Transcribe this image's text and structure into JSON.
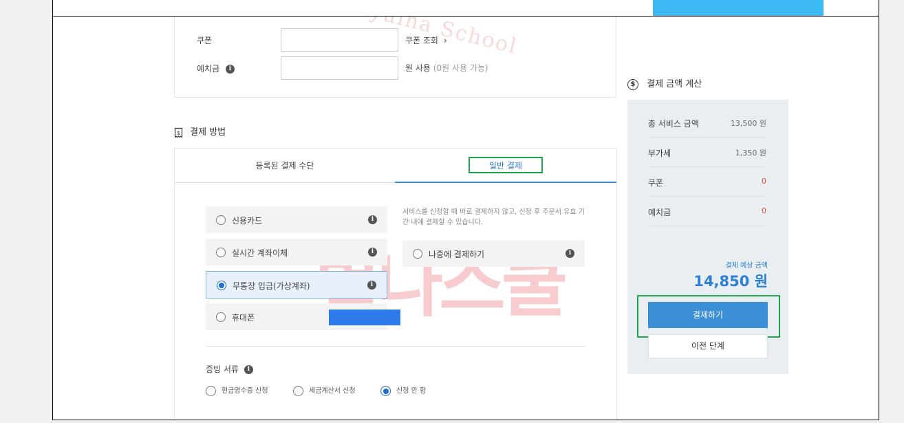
{
  "watermark": {
    "text": "Byulna School",
    "logo_text": "별나스쿨"
  },
  "coupon": {
    "label": "쿠폰",
    "value": "",
    "lookup_label": "쿠폰 조회",
    "lookup_icon": "chevron-right-icon"
  },
  "deposit": {
    "label": "예치금",
    "value": "",
    "use_label": "원 사용",
    "available": "(0원 사용 가능)"
  },
  "payment_method": {
    "title": "결제 방법",
    "icon": "receipt-dollar-icon",
    "tabs": [
      "등록된 결제 수단",
      "일반 결제"
    ],
    "active_tab": "일반 결제",
    "options": [
      {
        "label": "신용카드",
        "selected": false
      },
      {
        "label": "실시간 계좌이체",
        "selected": false
      },
      {
        "label": "무통장 입금(가상계좌)",
        "selected": true
      },
      {
        "label": "휴대폰",
        "selected": false
      }
    ],
    "later": {
      "description": "서비스를 신청할 때 바로 결제하지 않고, 신청 후 주문서 유효 기간 내에 결제할 수 있습니다.",
      "label": "나중에 결제하기"
    }
  },
  "documents": {
    "title": "증빙 서류",
    "options": [
      {
        "label": "현금영수증 신청",
        "selected": false
      },
      {
        "label": "세금계산서 신청",
        "selected": false
      },
      {
        "label": "신청 안 함",
        "selected": true
      }
    ]
  },
  "calc": {
    "title": "결제 금액 계산",
    "rows": [
      {
        "label": "총 서비스 금액",
        "value": "13,500 원"
      },
      {
        "label": "부가세",
        "value": "1,350 원"
      },
      {
        "label": "쿠폰",
        "value": "0"
      },
      {
        "label": "예치금",
        "value": "0"
      }
    ],
    "estimate_label": "결제 예상 금액",
    "estimate_amount": "14,850 원",
    "pay_button": "결제하기",
    "prev_button": "이전 단계"
  },
  "colors": {
    "accent": "#3b8fd6",
    "highlight_outline": "#1fa64a",
    "negative": "#e24b3b",
    "top_strip": "#3db9f5"
  }
}
